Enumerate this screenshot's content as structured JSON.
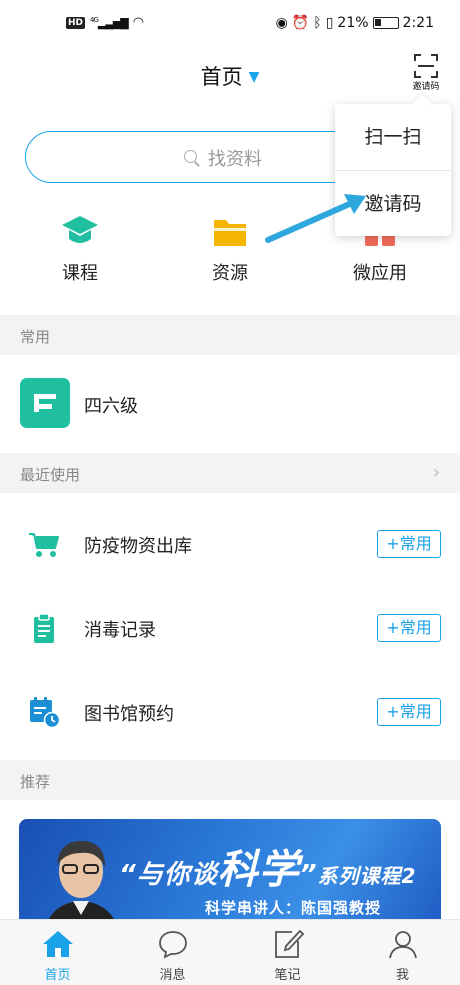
{
  "status_bar": {
    "left_badge": "HD",
    "network": "4G",
    "battery_pct": "21%",
    "time": "2:21"
  },
  "header": {
    "title": "首页",
    "invite_label": "邀请码"
  },
  "search": {
    "placeholder": "找资料"
  },
  "quick_actions": [
    {
      "label": "课程",
      "icon": "graduation-cap-icon",
      "color": "#1fbfa0"
    },
    {
      "label": "资源",
      "icon": "folder-icon",
      "color": "#f5b400"
    },
    {
      "label": "微应用",
      "icon": "apps-icon",
      "color": "#f26b5b"
    }
  ],
  "sections": {
    "common": "常用",
    "recent": "最近使用",
    "recommend": "推荐"
  },
  "common_items": [
    {
      "label": "四六级"
    }
  ],
  "recent_items": [
    {
      "label": "防疫物资出库",
      "icon": "cart-icon",
      "button": "+常用"
    },
    {
      "label": "消毒记录",
      "icon": "clipboard-icon",
      "button": "+常用"
    },
    {
      "label": "图书馆预约",
      "icon": "calendar-clock-icon",
      "button": "+常用"
    }
  ],
  "banner": {
    "quote_open": "“与你谈",
    "big": "科学",
    "quote_close": "”",
    "series": "系列课程2",
    "subtitle": "科学串讲人：陈国强教授"
  },
  "bottom_nav": [
    {
      "label": "首页",
      "icon": "home-icon",
      "active": true
    },
    {
      "label": "消息",
      "icon": "chat-icon",
      "active": false
    },
    {
      "label": "笔记",
      "icon": "note-icon",
      "active": false
    },
    {
      "label": "我",
      "icon": "person-icon",
      "active": false
    }
  ],
  "popup_menu": [
    {
      "label": "扫一扫"
    },
    {
      "label": "邀请码"
    }
  ],
  "colors": {
    "accent": "#1aa3e8",
    "teal": "#1fbfa0",
    "section_bg": "#f2f3f5"
  }
}
